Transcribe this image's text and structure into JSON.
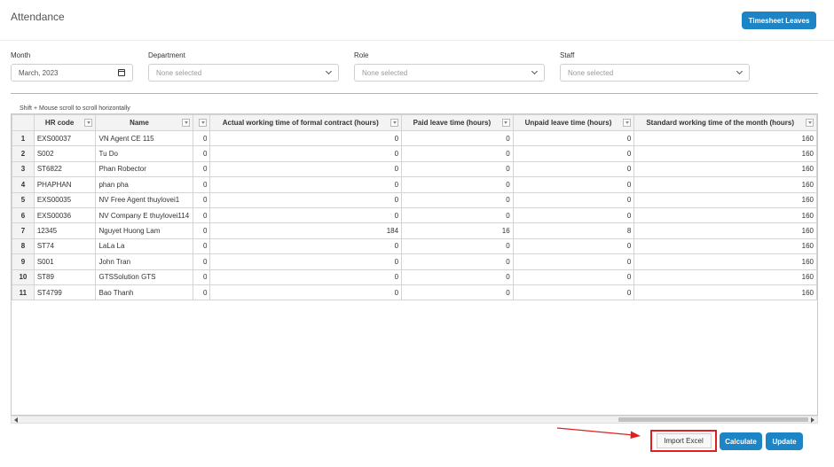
{
  "page": {
    "title": "Attendance"
  },
  "toolbar": {
    "timesheet_leaves": "Timesheet Leaves"
  },
  "filters": {
    "month": {
      "label": "Month",
      "value": "March, 2023"
    },
    "department": {
      "label": "Department",
      "placeholder": "None selected"
    },
    "role": {
      "label": "Role",
      "placeholder": "None selected"
    },
    "staff": {
      "label": "Staff",
      "placeholder": "None selected"
    }
  },
  "grid": {
    "hint": "Shift + Mouse scroll to scroll horizontally",
    "columns": [
      "HR code",
      "Name",
      "",
      "Actual working time of formal contract (hours)",
      "Paid leave time (hours)",
      "Unpaid leave time (hours)",
      "Standard working time of the month (hours)"
    ],
    "rows": [
      {
        "num": "1",
        "hr": "EXS00037",
        "name": "VN Agent CE 115",
        "c3": "0",
        "actual": "0",
        "paid": "0",
        "unpaid": "0",
        "standard": "160"
      },
      {
        "num": "2",
        "hr": "S002",
        "name": "Tu Do",
        "c3": "0",
        "actual": "0",
        "paid": "0",
        "unpaid": "0",
        "standard": "160"
      },
      {
        "num": "3",
        "hr": "ST6822",
        "name": "Phan Robector",
        "c3": "0",
        "actual": "0",
        "paid": "0",
        "unpaid": "0",
        "standard": "160"
      },
      {
        "num": "4",
        "hr": "PHAPHAN",
        "name": "phan pha",
        "c3": "0",
        "actual": "0",
        "paid": "0",
        "unpaid": "0",
        "standard": "160"
      },
      {
        "num": "5",
        "hr": "EXS00035",
        "name": "NV Free Agent thuylovei1",
        "c3": "0",
        "actual": "0",
        "paid": "0",
        "unpaid": "0",
        "standard": "160"
      },
      {
        "num": "6",
        "hr": "EXS00036",
        "name": "NV Company E thuylovei114",
        "c3": "0",
        "actual": "0",
        "paid": "0",
        "unpaid": "0",
        "standard": "160"
      },
      {
        "num": "7",
        "hr": "12345",
        "name": "Nguyet Huong Lam",
        "c3": "0",
        "actual": "184",
        "paid": "16",
        "unpaid": "8",
        "standard": "160"
      },
      {
        "num": "8",
        "hr": "ST74",
        "name": "LaLa La",
        "c3": "0",
        "actual": "0",
        "paid": "0",
        "unpaid": "0",
        "standard": "160"
      },
      {
        "num": "9",
        "hr": "S001",
        "name": "John Tran",
        "c3": "0",
        "actual": "0",
        "paid": "0",
        "unpaid": "0",
        "standard": "160"
      },
      {
        "num": "10",
        "hr": "ST89",
        "name": "GTSSolution GTS",
        "c3": "0",
        "actual": "0",
        "paid": "0",
        "unpaid": "0",
        "standard": "160"
      },
      {
        "num": "11",
        "hr": "ST4799",
        "name": "Bao Thanh",
        "c3": "0",
        "actual": "0",
        "paid": "0",
        "unpaid": "0",
        "standard": "160"
      }
    ]
  },
  "actions": {
    "import_excel": "Import Excel",
    "calculate": "Calculate",
    "update": "Update"
  },
  "colors": {
    "primary": "#1d84c6",
    "highlight": "#e02020",
    "divider": "#f0a079"
  }
}
